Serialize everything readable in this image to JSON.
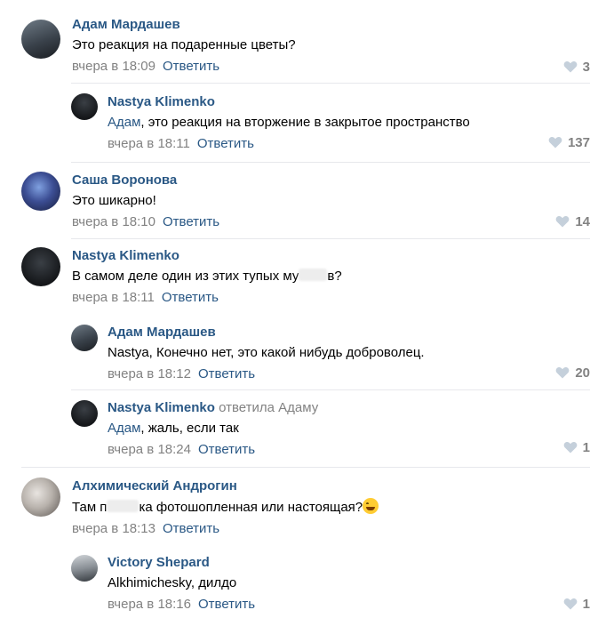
{
  "colors": {
    "link": "#2a5885",
    "meta": "#828282",
    "separator": "#e7e8ec",
    "like_icon": "#c5d0db"
  },
  "icons": {
    "like": "heart-icon",
    "emoji": "tears-of-joy-emoji"
  },
  "comments": [
    {
      "author": "Адам Мардашев",
      "text": "Это реакция на подаренные цветы?",
      "time": "вчера в 18:09",
      "reply_label": "Ответить",
      "likes": "3",
      "avatar": {
        "bg1": "#4a5560",
        "bg2": "#1e2126"
      }
    },
    {
      "author": "Nastya Klimenko",
      "mention": "Адам",
      "text": ", это реакция на вторжение в закрытое пространство",
      "time": "вчера в 18:11",
      "reply_label": "Ответить",
      "likes": "137",
      "avatar": {
        "bg1": "#2b2f34",
        "bg2": "#0d0e10"
      }
    },
    {
      "author": "Саша Воронова",
      "text": "Это шикарно!",
      "time": "вчера в 18:10",
      "reply_label": "Ответить",
      "likes": "14",
      "avatar": {
        "bg1": "#4b5fa8",
        "bg2": "#1f2a5c"
      }
    },
    {
      "author": "Nastya Klimenko",
      "text_before": "В самом деле один из этих тупых му",
      "text_after": "в?",
      "time": "вчера в 18:11",
      "reply_label": "Ответить",
      "likes": "",
      "avatar": {
        "bg1": "#2b2f34",
        "bg2": "#0d0e10"
      }
    },
    {
      "author": "Адам Мардашев",
      "text": "Nastya, Конечно нет, это какой нибудь доброволец.",
      "time": "вчера в 18:12",
      "reply_label": "Ответить",
      "likes": "20",
      "avatar": {
        "bg1": "#4a5560",
        "bg2": "#1e2126"
      }
    },
    {
      "author": "Nastya Klimenko",
      "replied": "ответила",
      "replied_to": "Адаму",
      "mention": "Адам",
      "text": ", жаль, если так",
      "time": "вчера в 18:24",
      "reply_label": "Ответить",
      "likes": "1",
      "avatar": {
        "bg1": "#2b2f34",
        "bg2": "#0d0e10"
      }
    },
    {
      "author": "Алхимический Андрогин",
      "text_before": "Там п",
      "text_after": "ка фотошопленная или настоящая?",
      "time": "вчера в 18:13",
      "reply_label": "Ответить",
      "likes": "",
      "avatar": {
        "bg1": "#d8d4d0",
        "bg2": "#8a8480"
      }
    },
    {
      "author": "Victory Shepard",
      "text": "Alkhimichesky, дилдо",
      "time": "вчера в 18:16",
      "reply_label": "Ответить",
      "likes": "1",
      "avatar": {
        "bg1": "#9aa0a6",
        "bg2": "#3e4348"
      }
    }
  ]
}
